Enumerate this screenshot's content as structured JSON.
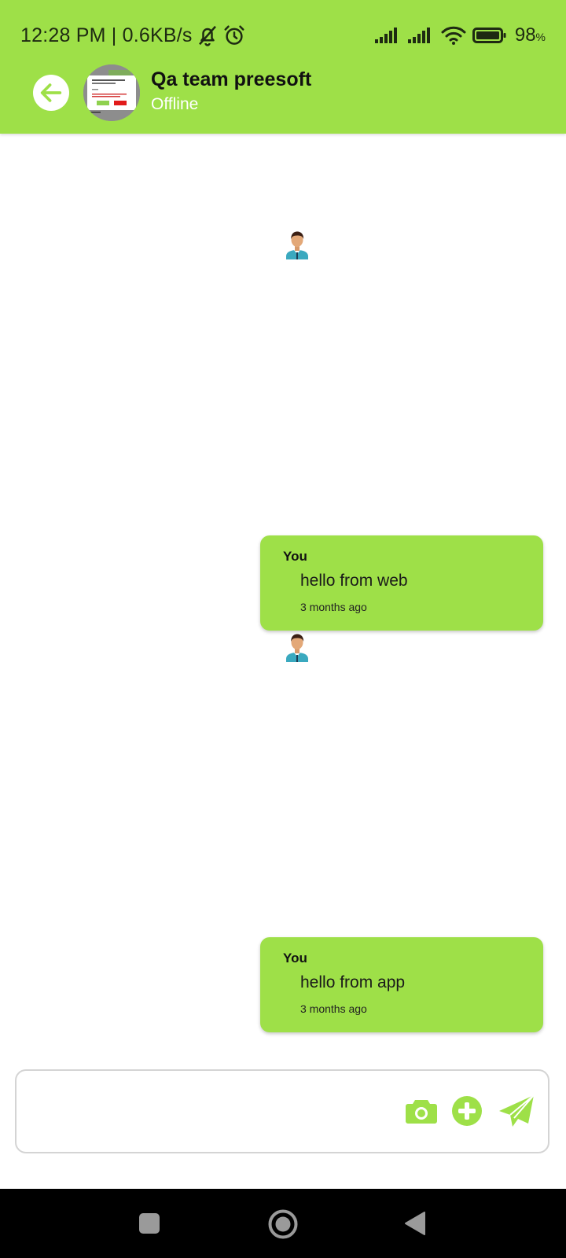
{
  "status_bar": {
    "time": "12:28 PM",
    "network_speed": "0.6KB/s",
    "battery_percent": "98",
    "battery_unit": "%",
    "icons": [
      "mute-bell-icon",
      "alarm-icon",
      "signal-icon",
      "signal-icon",
      "wifi-icon",
      "battery-icon"
    ]
  },
  "header": {
    "title": "Qa team preesoft",
    "status": "Offline",
    "back_icon": "arrow-left-icon"
  },
  "messages": [
    {
      "sender": "You",
      "text": "hello from web",
      "time": "3 months ago"
    },
    {
      "sender": "You",
      "text": "hello from app",
      "time": "3 months ago"
    }
  ],
  "composer": {
    "value": "",
    "placeholder": "",
    "icons": [
      "camera-icon",
      "plus-circle-icon",
      "send-icon"
    ]
  },
  "nav_bar": {
    "icons": [
      "recents-square-icon",
      "home-circle-icon",
      "back-triangle-icon"
    ]
  },
  "colors": {
    "accent": "#9ee048",
    "status_text": "#1e2a12",
    "nav_bar": "#000000",
    "bubble": "#9ee048"
  }
}
